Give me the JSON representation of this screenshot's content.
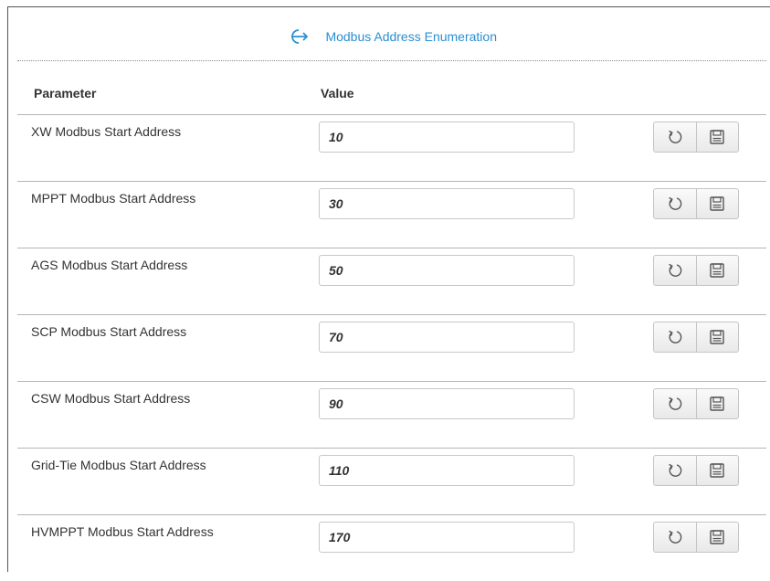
{
  "header": {
    "title": "Modbus Address Enumeration",
    "icon": "login-arrow-icon",
    "accent_color": "#2a8fd1"
  },
  "columns": {
    "parameter": "Parameter",
    "value": "Value"
  },
  "rows": [
    {
      "label": "XW Modbus Start Address",
      "value": "10"
    },
    {
      "label": "MPPT Modbus Start Address",
      "value": "30"
    },
    {
      "label": "AGS Modbus Start Address",
      "value": "50"
    },
    {
      "label": "SCP Modbus Start Address",
      "value": "70"
    },
    {
      "label": "CSW Modbus Start Address",
      "value": "90"
    },
    {
      "label": "Grid-Tie Modbus Start Address",
      "value": "110"
    },
    {
      "label": "HVMPPT Modbus Start Address",
      "value": "170"
    }
  ],
  "row_actions": {
    "refresh_icon": "refresh-icon",
    "save_icon": "save-icon"
  }
}
